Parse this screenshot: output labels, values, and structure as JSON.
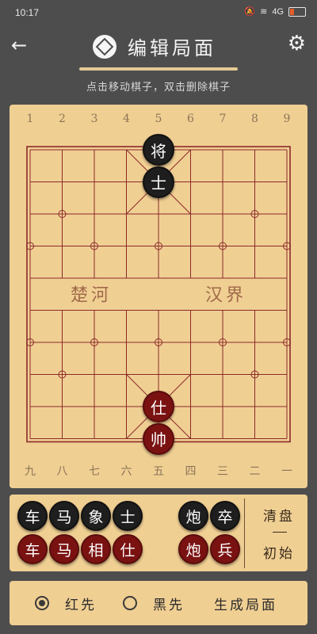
{
  "status": {
    "time": "10:17",
    "signal": "4G",
    "battery_icon": "battery-icon"
  },
  "header": {
    "title": "编辑局面",
    "back_icon": "back-arrow-icon",
    "settings_icon": "gear-icon"
  },
  "hint": "点击移动棋子，双击删除棋子",
  "board": {
    "top_numbers": [
      "1",
      "2",
      "3",
      "4",
      "5",
      "6",
      "7",
      "8",
      "9"
    ],
    "bottom_numbers": [
      "九",
      "八",
      "七",
      "六",
      "五",
      "四",
      "三",
      "二",
      "一"
    ],
    "river_left": "楚河",
    "river_right": "汉界",
    "pieces": [
      {
        "char": "将",
        "color": "black",
        "col": 4,
        "row": 0
      },
      {
        "char": "士",
        "color": "black",
        "col": 4,
        "row": 1
      },
      {
        "char": "仕",
        "color": "red",
        "col": 4,
        "row": 8
      },
      {
        "char": "帅",
        "color": "red",
        "col": 4,
        "row": 9
      }
    ]
  },
  "tray": {
    "black_pieces": [
      "车",
      "马",
      "象",
      "士",
      "炮",
      "卒"
    ],
    "red_pieces": [
      "车",
      "马",
      "相",
      "仕",
      "炮",
      "兵"
    ],
    "clear_label": "清盘",
    "initial_label": "初始"
  },
  "options": {
    "red_first_label": "红先",
    "black_first_label": "黑先",
    "selected": "red",
    "generate_label": "生成局面"
  },
  "colors": {
    "board": "#f0cf93",
    "line": "#8b2a2a",
    "background": "#4d4d4d"
  }
}
